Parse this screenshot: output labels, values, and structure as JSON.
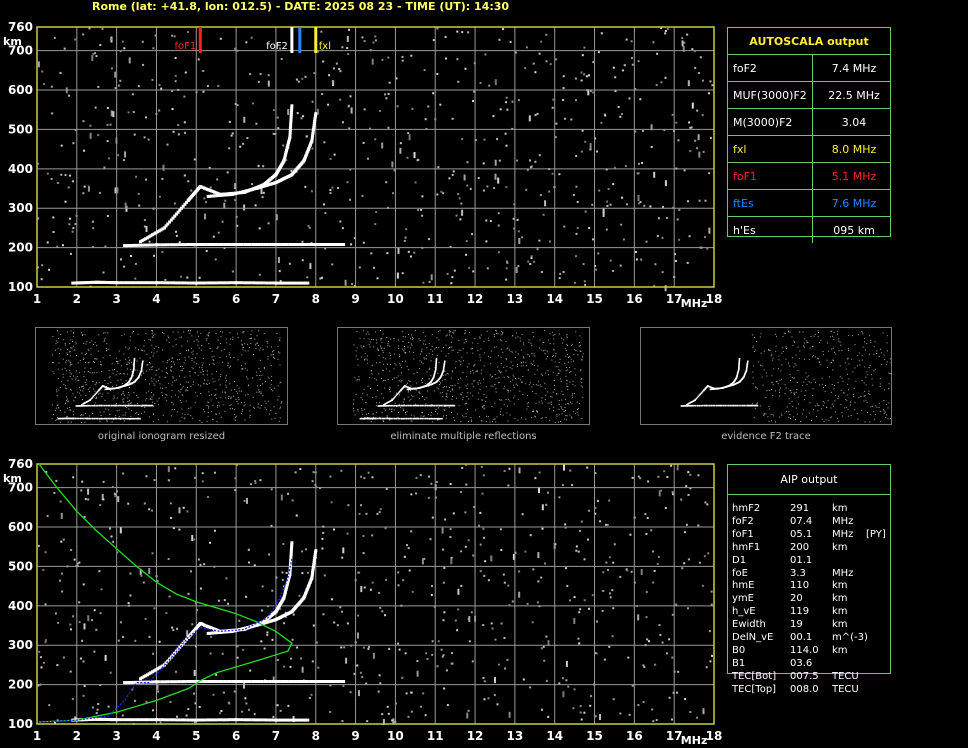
{
  "header": {
    "title": "Rome (lat: +41.8, lon: 012.5) - DATE: 2025 08 23 - TIME (UT): 14:30"
  },
  "colors": {
    "grid": "#999999",
    "frame": "#cccc44",
    "fof1": "#ff2222",
    "foes": "#2288ff",
    "fxl": "#ffee33",
    "profile": "#22dd22",
    "aip_points": "#2222ff"
  },
  "chart_data": [
    {
      "type": "scatter",
      "title": "",
      "xlabel": "MHz",
      "ylabel": "km",
      "xlim": [
        1,
        18
      ],
      "ylim": [
        100,
        760
      ],
      "grid": true,
      "x_ticks": [
        1,
        2,
        3,
        4,
        5,
        6,
        7,
        8,
        9,
        10,
        11,
        12,
        13,
        14,
        15,
        16,
        17,
        18
      ],
      "y_ticks": [
        100,
        200,
        300,
        400,
        500,
        600,
        700
      ],
      "markers": [
        {
          "label": "foF1",
          "x": 5.1,
          "color": "#ff2222"
        },
        {
          "label": "foF2",
          "x": 7.4,
          "color": "#ffffff"
        },
        {
          "label": "",
          "x": 7.6,
          "color": "#2288ff"
        },
        {
          "label": "fxl",
          "x": 8.0,
          "color": "#ffee33"
        }
      ],
      "traces": [
        {
          "name": "",
          "points": [
            [
              1.9,
              110
            ],
            [
              2.5,
              112
            ],
            [
              3,
              111
            ],
            [
              4,
              111
            ],
            [
              5,
              110
            ],
            [
              6,
              111
            ],
            [
              7,
              110
            ],
            [
              7.8,
              110
            ]
          ]
        },
        {
          "name": "",
          "points": [
            [
              3.2,
              205
            ],
            [
              4,
              207
            ],
            [
              5,
              208
            ],
            [
              6,
              208
            ],
            [
              7,
              208
            ],
            [
              8,
              208
            ],
            [
              8.7,
              208
            ]
          ]
        },
        {
          "name": "",
          "points": [
            [
              3.6,
              215
            ],
            [
              4.2,
              250
            ],
            [
              4.8,
              320
            ],
            [
              5.1,
              355
            ],
            [
              5.6,
              335
            ],
            [
              6.2,
              340
            ],
            [
              6.7,
              360
            ],
            [
              7.0,
              385
            ],
            [
              7.2,
              420
            ],
            [
              7.35,
              480
            ],
            [
              7.4,
              560
            ]
          ]
        },
        {
          "name": "",
          "points": [
            [
              5.3,
              330
            ],
            [
              5.9,
              335
            ],
            [
              6.5,
              350
            ],
            [
              7.0,
              365
            ],
            [
              7.4,
              385
            ],
            [
              7.7,
              420
            ],
            [
              7.9,
              470
            ],
            [
              8.0,
              540
            ]
          ]
        }
      ]
    },
    {
      "type": "line",
      "title": "",
      "xlabel": "MHz",
      "ylabel": "km",
      "xlim": [
        1,
        18
      ],
      "ylim": [
        100,
        760
      ],
      "grid": true,
      "x_ticks": [
        1,
        2,
        3,
        4,
        5,
        6,
        7,
        8,
        9,
        10,
        11,
        12,
        13,
        14,
        15,
        16,
        17,
        18
      ],
      "y_ticks": [
        100,
        200,
        300,
        400,
        500,
        600,
        700
      ],
      "series": [
        {
          "name": "",
          "color": "#22dd22",
          "points": [
            [
              1.05,
              760
            ],
            [
              1.5,
              700
            ],
            [
              2,
              640
            ],
            [
              2.5,
              590
            ],
            [
              3,
              545
            ],
            [
              3.5,
              500
            ],
            [
              4,
              460
            ],
            [
              4.5,
              430
            ],
            [
              5,
              410
            ],
            [
              5.5,
              395
            ],
            [
              6,
              380
            ],
            [
              6.5,
              360
            ],
            [
              7,
              335
            ],
            [
              7.4,
              305
            ],
            [
              7.3,
              285
            ],
            [
              6.5,
              260
            ],
            [
              5.5,
              230
            ],
            [
              5.1,
              210
            ],
            [
              4.8,
              190
            ],
            [
              4,
              160
            ],
            [
              3,
              130
            ],
            [
              2,
              110
            ],
            [
              1.05,
              105
            ]
          ]
        },
        {
          "name": "",
          "color": "#2222ff",
          "points": [
            [
              1.1,
              105
            ],
            [
              2,
              110
            ],
            [
              2.8,
              120
            ],
            [
              3.2,
              160
            ],
            [
              3.5,
              205
            ],
            [
              3.8,
              205
            ],
            [
              4.3,
              260
            ],
            [
              4.8,
              320
            ],
            [
              5.1,
              345
            ],
            [
              5.6,
              335
            ],
            [
              6.2,
              340
            ],
            [
              6.8,
              370
            ],
            [
              7.1,
              420
            ],
            [
              7.3,
              470
            ],
            [
              7.4,
              520
            ]
          ]
        }
      ],
      "traces": [
        {
          "name": "",
          "points": [
            [
              1.9,
              110
            ],
            [
              2.5,
              112
            ],
            [
              3,
              111
            ],
            [
              4,
              111
            ],
            [
              5,
              110
            ],
            [
              6,
              111
            ],
            [
              7,
              110
            ],
            [
              7.8,
              110
            ]
          ]
        },
        {
          "name": "",
          "points": [
            [
              3.2,
              205
            ],
            [
              4,
              207
            ],
            [
              5,
              208
            ],
            [
              6,
              208
            ],
            [
              7,
              208
            ],
            [
              8,
              208
            ],
            [
              8.7,
              208
            ]
          ]
        },
        {
          "name": "",
          "points": [
            [
              3.6,
              215
            ],
            [
              4.2,
              250
            ],
            [
              4.8,
              320
            ],
            [
              5.1,
              355
            ],
            [
              5.6,
              335
            ],
            [
              6.2,
              340
            ],
            [
              6.7,
              360
            ],
            [
              7.0,
              385
            ],
            [
              7.2,
              420
            ],
            [
              7.35,
              480
            ],
            [
              7.4,
              560
            ]
          ]
        },
        {
          "name": "",
          "points": [
            [
              5.3,
              330
            ],
            [
              5.9,
              335
            ],
            [
              6.5,
              350
            ],
            [
              7.0,
              365
            ],
            [
              7.4,
              385
            ],
            [
              7.7,
              420
            ],
            [
              7.9,
              470
            ],
            [
              8.0,
              540
            ]
          ]
        }
      ]
    }
  ],
  "autoscala": {
    "title": "AUTOSCALA output",
    "rows": [
      {
        "name": "foF2",
        "value": "7.4 MHz",
        "color": "#ffffff"
      },
      {
        "name": "MUF(3000)F2",
        "value": "22.5 MHz",
        "color": "#ffffff"
      },
      {
        "name": "M(3000)F2",
        "value": "3.04",
        "color": "#ffffff"
      },
      {
        "name": "fxl",
        "value": "8.0 MHz",
        "color": "#ffee33"
      },
      {
        "name": "foF1",
        "value": "5.1 MHz",
        "color": "#ff2222"
      },
      {
        "name": "ftEs",
        "value": "7.6 MHz",
        "color": "#2288ff"
      },
      {
        "name": "h'Es",
        "value": "095    km",
        "color": "#ffffff"
      }
    ]
  },
  "thumbnails": {
    "captions": [
      "original ionogram resized",
      "eliminate multiple reflections",
      "evidence F2 trace"
    ]
  },
  "aip": {
    "title": "AIP output",
    "rows": [
      {
        "name": "hmF2",
        "value": "291",
        "unit": "km",
        "extra": ""
      },
      {
        "name": "foF2",
        "value": "07.4",
        "unit": "MHz",
        "extra": ""
      },
      {
        "name": "foF1",
        "value": "05.1",
        "unit": "MHz",
        "extra": "[PY]"
      },
      {
        "name": "hmF1",
        "value": "200",
        "unit": "km",
        "extra": ""
      },
      {
        "name": "D1",
        "value": "01.1",
        "unit": "",
        "extra": ""
      },
      {
        "name": "foE",
        "value": "3.3",
        "unit": "MHz",
        "extra": ""
      },
      {
        "name": "hmE",
        "value": "110",
        "unit": "km",
        "extra": ""
      },
      {
        "name": "ymE",
        "value": "20",
        "unit": "km",
        "extra": ""
      },
      {
        "name": "h_vE",
        "value": "119",
        "unit": "km",
        "extra": ""
      },
      {
        "name": "Ewidth",
        "value": "19",
        "unit": "km",
        "extra": ""
      },
      {
        "name": "DelN_vE",
        "value": "00.1",
        "unit": "m^(-3)",
        "extra": ""
      },
      {
        "name": "B0",
        "value": "114.0",
        "unit": "km",
        "extra": ""
      },
      {
        "name": "B1",
        "value": "03.6",
        "unit": "",
        "extra": ""
      },
      {
        "name": "TEC[Bot]",
        "value": "007.5",
        "unit": "TECU",
        "extra": ""
      },
      {
        "name": "TEC[Top]",
        "value": "008.0",
        "unit": "TECU",
        "extra": ""
      }
    ]
  }
}
